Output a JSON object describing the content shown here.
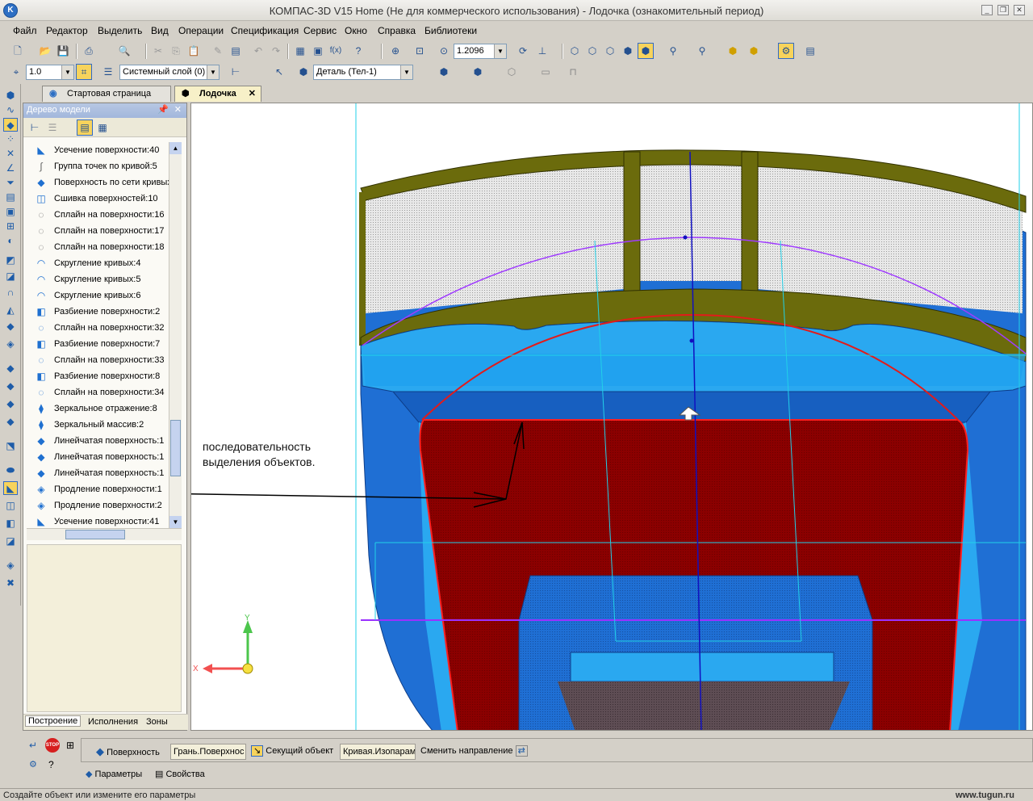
{
  "window": {
    "title": "КОМПАС-3D V15 Home (Не для коммерческого использования) - Лодочка (ознакомительный период)"
  },
  "menu": [
    "Файл",
    "Редактор",
    "Выделить",
    "Вид",
    "Операции",
    "Спецификация",
    "Сервис",
    "Окно",
    "Справка",
    "Библиотеки"
  ],
  "toolbar": {
    "zoom_value": "1.2096",
    "scale_value": "1.0",
    "layer_value": "Системный слой (0)",
    "part_value": "Деталь (Тел-1)"
  },
  "tabs": [
    {
      "label": "Стартовая страница"
    },
    {
      "label": "Лодочка"
    }
  ],
  "tree": {
    "title": "Дерево модели",
    "items": [
      "Усечение поверхности:40",
      "Группа точек по кривой:5",
      "Поверхность по сети кривых",
      "Сшивка поверхностей:10",
      "Сплайн на поверхности:16",
      "Сплайн на поверхности:17",
      "Сплайн на поверхности:18",
      "Скругление кривых:4",
      "Скругление кривых:5",
      "Скругление кривых:6",
      "Разбиение поверхности:2",
      "Сплайн на поверхности:32",
      "Разбиение поверхности:7",
      "Сплайн на поверхности:33",
      "Разбиение поверхности:8",
      "Сплайн на поверхности:34",
      "Зеркальное отражение:8",
      "Зеркальный массив:2",
      "Линейчатая поверхность:1",
      "Линейчатая поверхность:1",
      "Линейчатая поверхность:1",
      "Продление поверхности:1",
      "Продление поверхности:2",
      "Усечение поверхности:41"
    ],
    "bottom_tabs": [
      "Построение",
      "Исполнения",
      "Зоны"
    ]
  },
  "viewport": {
    "annotation_line1": "последовательность",
    "annotation_line2": "выделения объектов.",
    "axis_x": "X",
    "axis_y": "Y"
  },
  "properties": {
    "surface_label": "Поверхность",
    "surface_value": "Грань.Поверхнос",
    "cutter_label": "Секущий объект",
    "cutter_value": "Кривая.Изопарам",
    "direction_label": "Сменить направление",
    "tab_params": "Параметры",
    "tab_props": "Свойства",
    "stop_label": "STOP"
  },
  "status": {
    "text": "Создайте объект или измените его параметры",
    "watermark": "www.tugun.ru"
  }
}
